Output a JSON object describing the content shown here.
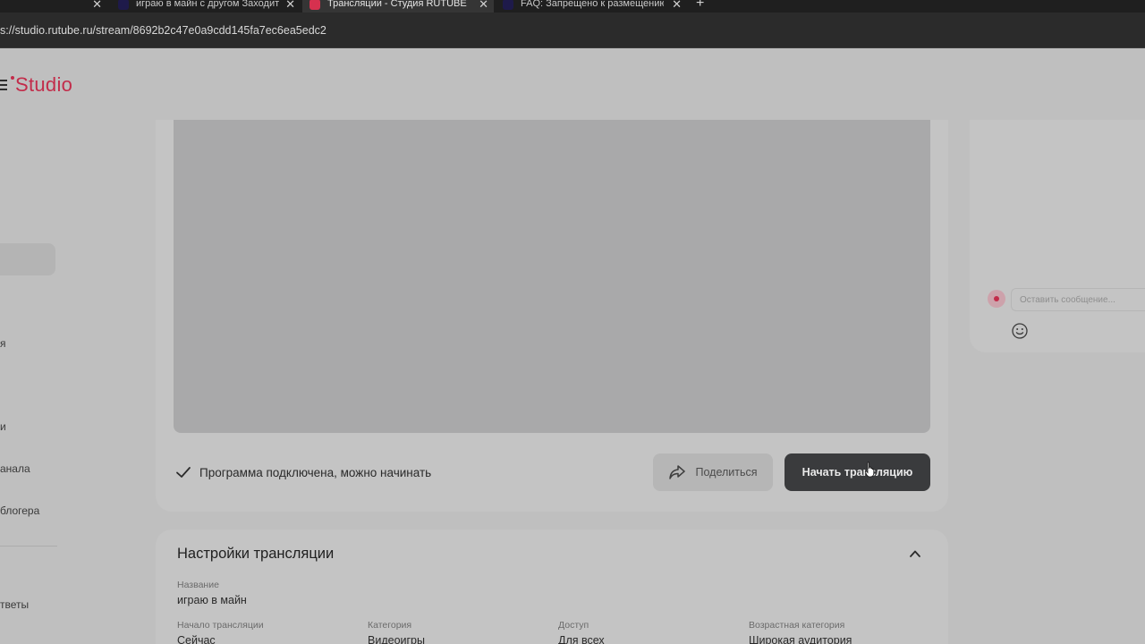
{
  "browser": {
    "tabs": [
      {
        "title": "",
        "favicon_color": "#000000"
      },
      {
        "title": "играю в майн с другом Заходите",
        "favicon_color": "#1e1a4a"
      },
      {
        "title": "Трансляции - Студия RUTUBE",
        "favicon_color": "#d6314f"
      },
      {
        "title": "FAQ: Запрещено к размещению",
        "favicon_color": "#1e1a4a"
      }
    ],
    "new_tab_label": "+",
    "url": "s://studio.rutube.ru/stream/8692b2c47e0a9cdd145fa7ec6ea5edc2"
  },
  "logo": {
    "text": "Studio",
    "accent": "#c22c4a"
  },
  "sidebar": {
    "items": [
      "я",
      "и",
      "анала",
      "блогера",
      "тветы"
    ]
  },
  "stream": {
    "status_text": "Программа подключена, можно начинать",
    "share_label": "Поделиться",
    "start_label": "Начать трансляцию"
  },
  "chat": {
    "input_placeholder": "Оставить сообщение..."
  },
  "settings": {
    "title": "Настройки трансляции",
    "name_label": "Название",
    "name_value": "играю в майн",
    "fields": [
      {
        "label": "Начало трансляции",
        "value": "Сейчас"
      },
      {
        "label": "Категория",
        "value": "Видеоигры"
      },
      {
        "label": "Доступ",
        "value": "Для всех"
      },
      {
        "label": "Возрастная категория",
        "value": "Широкая аудитория"
      }
    ]
  }
}
